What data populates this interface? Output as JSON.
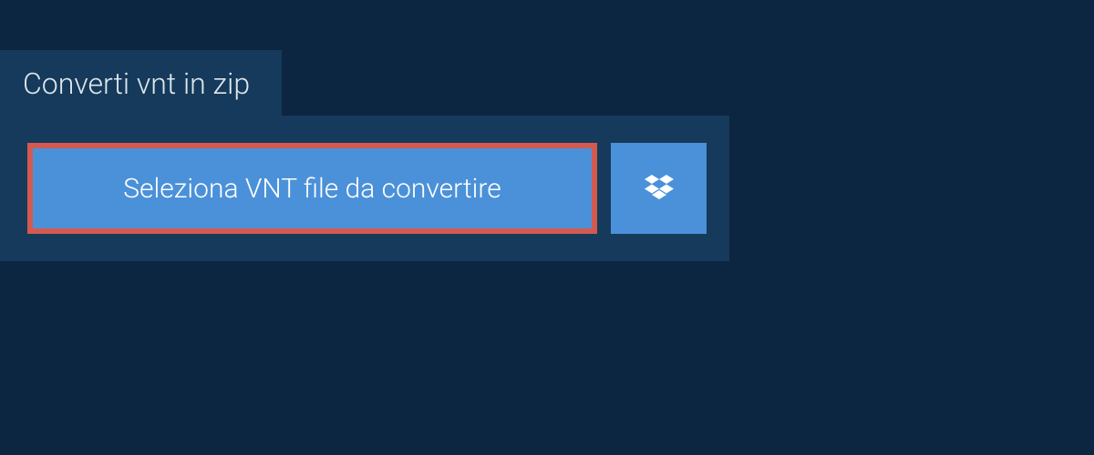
{
  "tab": {
    "title": "Converti vnt in zip"
  },
  "actions": {
    "select_file_label": "Seleziona VNT file da convertire"
  },
  "colors": {
    "background": "#0c2540",
    "panel": "#153a5b",
    "button": "#4b91d9",
    "highlight_border": "#d35a50"
  }
}
